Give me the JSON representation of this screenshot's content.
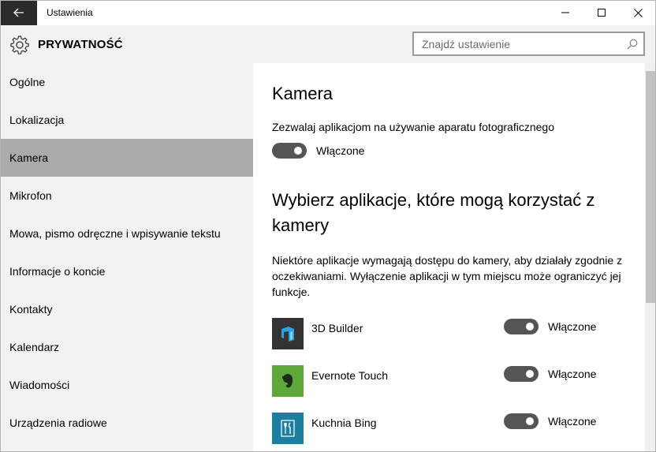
{
  "window": {
    "title": "Ustawienia"
  },
  "header": {
    "section_title": "PRYWATNOŚĆ",
    "search_placeholder": "Znajdź ustawienie"
  },
  "sidebar": {
    "items": [
      {
        "label": "Ogólne"
      },
      {
        "label": "Lokalizacja"
      },
      {
        "label": "Kamera",
        "active": true
      },
      {
        "label": "Mikrofon"
      },
      {
        "label": "Mowa, pismo odręczne i wpisywanie tekstu"
      },
      {
        "label": "Informacje o koncie"
      },
      {
        "label": "Kontakty"
      },
      {
        "label": "Kalendarz"
      },
      {
        "label": "Wiadomości"
      },
      {
        "label": "Urządzenia radiowe"
      }
    ]
  },
  "main": {
    "heading": "Kamera",
    "allow_label": "Zezwalaj aplikacjom na używanie aparatu fotograficznego",
    "allow_toggle": {
      "state": "Włączone",
      "on": true
    },
    "apps_heading": "Wybierz aplikacje, które mogą korzystać z kamery",
    "description": "Niektóre aplikacje wymagają dostępu do kamery, aby działały zgodnie z oczekiwaniami. Wyłączenie aplikacji w tym miejscu może ograniczyć jej funkcje.",
    "apps": [
      {
        "name": "3D Builder",
        "state": "Włączone",
        "on": true,
        "icon": "3d-builder-icon",
        "color": "#333333"
      },
      {
        "name": "Evernote Touch",
        "state": "Włączone",
        "on": true,
        "icon": "evernote-icon",
        "color": "#5ea83a"
      },
      {
        "name": "Kuchnia Bing",
        "state": "Włączone",
        "on": true,
        "icon": "fork-knife-icon",
        "color": "#1b7fa0"
      }
    ]
  },
  "colors": {
    "sidebar_bg": "#f2f2f2",
    "active_item_bg": "#aaaaaa",
    "toggle_on": "#555555",
    "back_button_bg": "#2b2b2b"
  }
}
